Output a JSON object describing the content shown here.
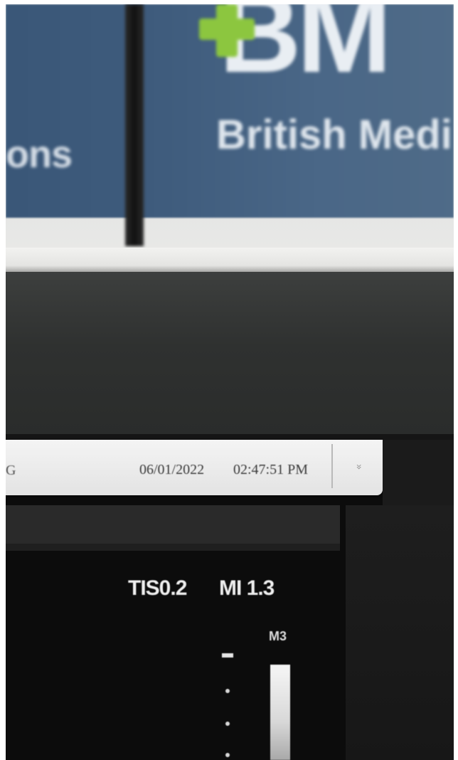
{
  "background": {
    "banner_left_text": "ons",
    "logo_letters": "BM",
    "logo_sub": "British Medi",
    "colors": {
      "banner": "#3f5c7d",
      "logo_cross": "#8cc63f",
      "bezel": "#2f3130"
    }
  },
  "header": {
    "left_fragment": "G",
    "date": "06/01/2022",
    "time": "02:47:51 PM",
    "expand_icon": "chevron-double-down-icon",
    "expand_glyph": "»"
  },
  "imaging": {
    "tis": "TIS0.2",
    "mi": "MI 1.3",
    "probe": "M3",
    "colors": {
      "text": "#efefef",
      "screen_bg": "#0c0c0c"
    }
  }
}
